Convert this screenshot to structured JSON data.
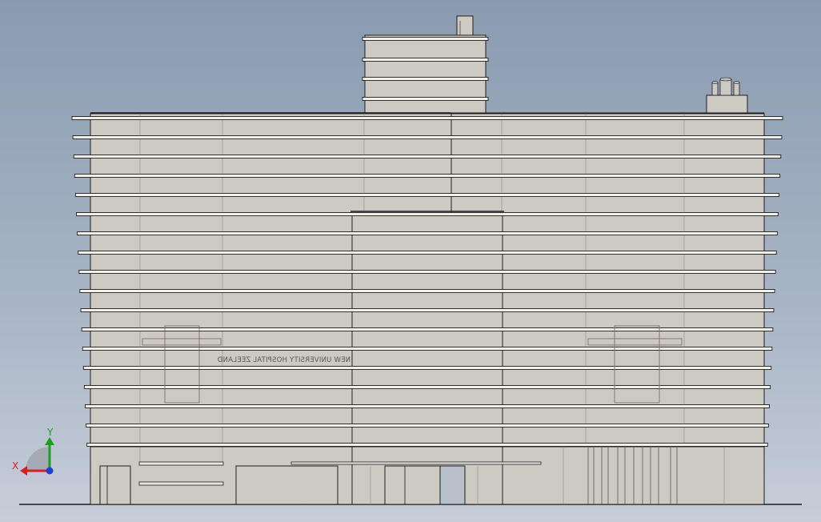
{
  "view": {
    "mode": "cad-elevation-view",
    "colors": {
      "background_top": "#8a9bb0",
      "background_bottom": "#c6ced9",
      "facade": "#cdc9c3",
      "edge": "#1e1e1e",
      "slab": "#f2efe9",
      "window": "#b8c0cc",
      "axis_x": "#d42020",
      "axis_y": "#18a018",
      "axis_z": "#2040d0"
    }
  },
  "building": {
    "sign_text": "NEW UNIVERSITY HOSPITAL ZEELAND"
  },
  "triad": {
    "x_label": "X",
    "y_label": "Y"
  }
}
